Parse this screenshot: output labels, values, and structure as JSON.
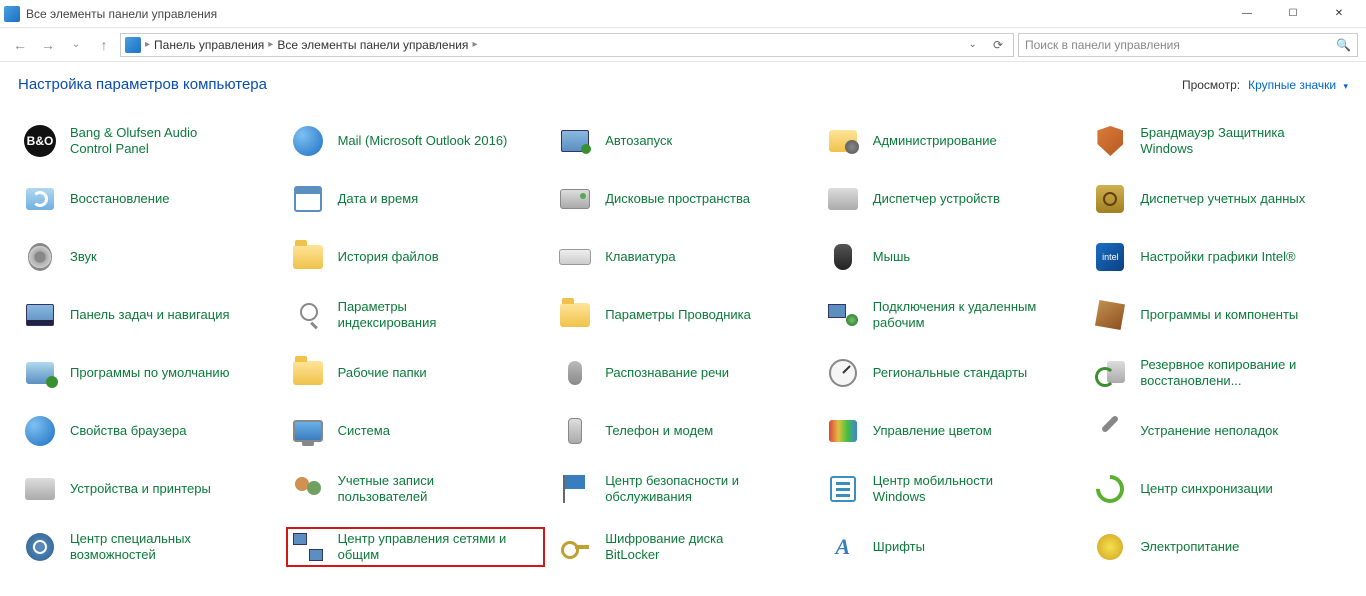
{
  "window": {
    "title": "Все элементы панели управления"
  },
  "breadcrumb": {
    "root": "Панель управления",
    "current": "Все элементы панели управления"
  },
  "search": {
    "placeholder": "Поиск в панели управления"
  },
  "header": {
    "heading": "Настройка параметров компьютера",
    "view_label": "Просмотр:",
    "view_value": "Крупные значки"
  },
  "items": [
    {
      "id": "bang-olufsen",
      "label": "Bang & Olufsen Audio Control Panel",
      "iconClass": "ico-circle-dark",
      "iconText": "B&O"
    },
    {
      "id": "mail",
      "label": "Mail (Microsoft Outlook 2016)",
      "iconClass": "ico-globe"
    },
    {
      "id": "autorun",
      "label": "Автозапуск",
      "iconClass": "ico-autostart"
    },
    {
      "id": "admin",
      "label": "Администрирование",
      "iconClass": "ico-admin"
    },
    {
      "id": "firewall",
      "label": "Брандмауэр Защитника Windows",
      "iconClass": "ico-shield"
    },
    {
      "id": "recovery",
      "label": "Восстановление",
      "iconClass": "ico-recovery"
    },
    {
      "id": "datetime",
      "label": "Дата и время",
      "iconClass": "ico-calendar"
    },
    {
      "id": "storage",
      "label": "Дисковые пространства",
      "iconClass": "ico-disk"
    },
    {
      "id": "devmgr",
      "label": "Диспетчер устройств",
      "iconClass": "ico-printer"
    },
    {
      "id": "credmgr",
      "label": "Диспетчер учетных данных",
      "iconClass": "ico-safe"
    },
    {
      "id": "sound",
      "label": "Звук",
      "iconClass": "ico-speaker"
    },
    {
      "id": "filehist",
      "label": "История файлов",
      "iconClass": "ico-folder"
    },
    {
      "id": "keyboard",
      "label": "Клавиатура",
      "iconClass": "ico-keyboard"
    },
    {
      "id": "mouse",
      "label": "Мышь",
      "iconClass": "ico-mouse"
    },
    {
      "id": "intelgfx",
      "label": "Настройки графики Intel®",
      "iconClass": "ico-chip",
      "iconText": "intel"
    },
    {
      "id": "taskbar",
      "label": "Панель задач и навигация",
      "iconClass": "ico-taskbar"
    },
    {
      "id": "indexing",
      "label": "Параметры индексирования",
      "iconClass": "ico-index"
    },
    {
      "id": "explorer-opts",
      "label": "Параметры Проводника",
      "iconClass": "ico-folder"
    },
    {
      "id": "remote",
      "label": "Подключения к удаленным рабочим",
      "iconClass": "ico-remote"
    },
    {
      "id": "programs",
      "label": "Программы и компоненты",
      "iconClass": "ico-cube"
    },
    {
      "id": "default-programs",
      "label": "Программы по умолчанию",
      "iconClass": "ico-defapp"
    },
    {
      "id": "work-folders",
      "label": "Рабочие папки",
      "iconClass": "ico-folder"
    },
    {
      "id": "speech",
      "label": "Распознавание речи",
      "iconClass": "ico-mic"
    },
    {
      "id": "region",
      "label": "Региональные стандарты",
      "iconClass": "ico-clock"
    },
    {
      "id": "backup",
      "label": "Резервное копирование и восстановлени...",
      "iconClass": "ico-backup"
    },
    {
      "id": "browser-props",
      "label": "Свойства браузера",
      "iconClass": "ico-globe"
    },
    {
      "id": "system",
      "label": "Система",
      "iconClass": "ico-monitor"
    },
    {
      "id": "phone-modem",
      "label": "Телефон и модем",
      "iconClass": "ico-phone"
    },
    {
      "id": "color-mgmt",
      "label": "Управление цветом",
      "iconClass": "ico-color"
    },
    {
      "id": "troubleshoot",
      "label": "Устранение неполадок",
      "iconClass": "ico-wrench"
    },
    {
      "id": "devices-printers",
      "label": "Устройства и принтеры",
      "iconClass": "ico-printer"
    },
    {
      "id": "user-accounts",
      "label": "Учетные записи пользователей",
      "iconClass": "ico-people"
    },
    {
      "id": "security-center",
      "label": "Центр безопасности и обслуживания",
      "iconClass": "ico-flag"
    },
    {
      "id": "mobility",
      "label": "Центр мобильности Windows",
      "iconClass": "ico-list"
    },
    {
      "id": "sync-center",
      "label": "Центр синхронизации",
      "iconClass": "ico-sync"
    },
    {
      "id": "ease-of-access",
      "label": "Центр специальных возможностей",
      "iconClass": "ico-access"
    },
    {
      "id": "network-sharing",
      "label": "Центр управления сетями и общим",
      "iconClass": "ico-network",
      "highlighted": true
    },
    {
      "id": "bitlocker",
      "label": "Шифрование диска BitLocker",
      "iconClass": "ico-key"
    },
    {
      "id": "fonts",
      "label": "Шрифты",
      "iconClass": "ico-font",
      "iconText": "A"
    },
    {
      "id": "power",
      "label": "Электропитание",
      "iconClass": "ico-power"
    }
  ]
}
